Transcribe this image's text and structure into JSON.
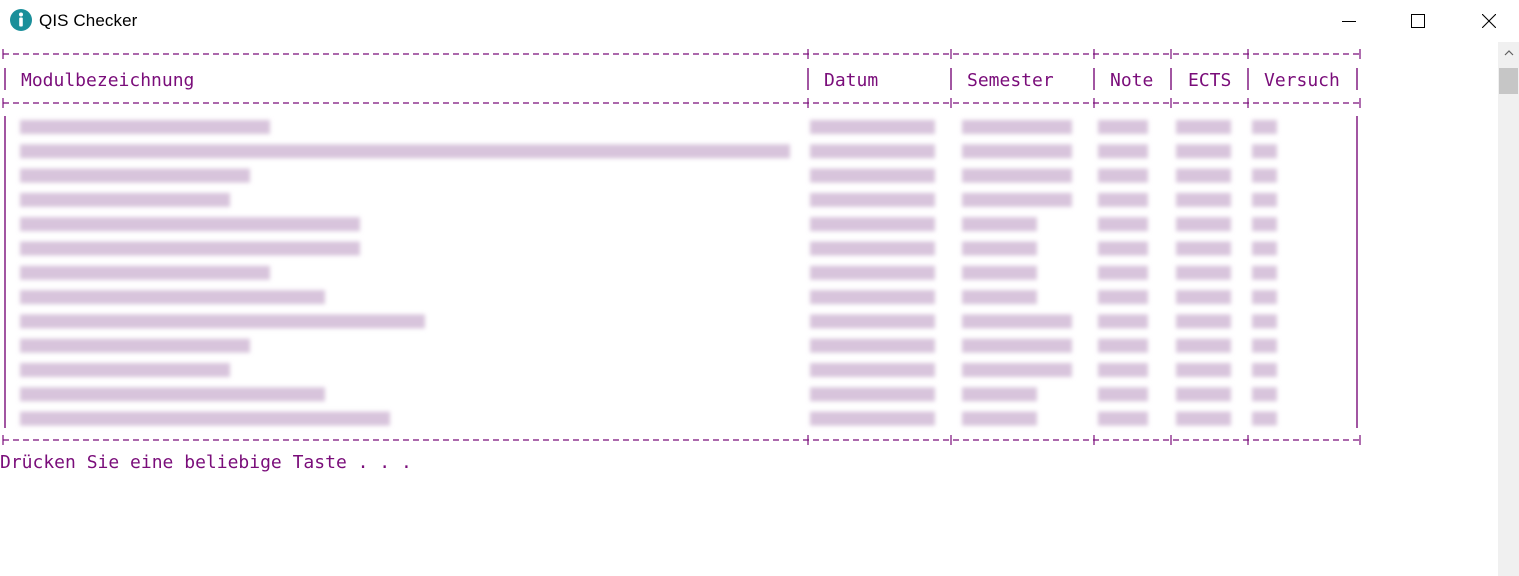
{
  "window": {
    "title": "QIS Checker"
  },
  "icons": {
    "app": "info-icon",
    "minimize": "minimize-icon",
    "maximize": "maximize-icon",
    "close": "close-icon",
    "scroll_up": "chevron-up-icon"
  },
  "colors": {
    "console_text": "#7a0d7a",
    "blurred_text": "#d8c4dc",
    "app_icon": "#1a8f9a"
  },
  "table": {
    "headers": [
      "Modulbezeichnung",
      "Datum",
      "Semester",
      "Note",
      "ECTS",
      "Versuch"
    ],
    "row_count_visible": 13
  },
  "prompt": "Drücken Sie eine beliebige Taste . . ."
}
